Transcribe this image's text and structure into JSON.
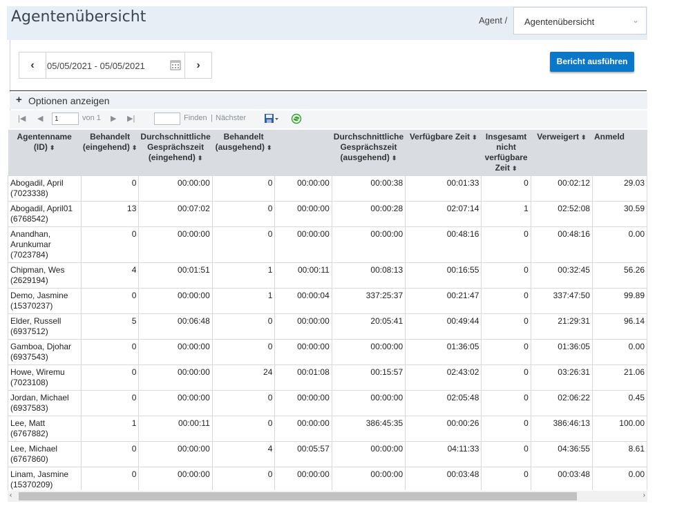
{
  "header": {
    "title": "Agentenübersicht",
    "breadcrumb": "Agent /",
    "select_value": "Agentenübersicht"
  },
  "date_range": {
    "value": "05/05/2021 - 05/05/2021"
  },
  "run_button": "Bericht ausführen",
  "options": {
    "label": "Optionen anzeigen"
  },
  "pager": {
    "page": "1",
    "of": "von 1",
    "find": "Finden",
    "divider": "|",
    "next": "Nächster"
  },
  "columns": [
    "Agentenname (ID)",
    "Behandelt (eingehend)",
    "Durchschnittliche Gesprächszeit (eingehend)",
    "Behandelt (ausgehend)",
    "",
    "Durchschnittliche Gesprächszeit (ausgehend)",
    "Verfügbare Zeit",
    "Insgesamt nicht verfügbare Zeit",
    "Verweigert",
    "Anmeld"
  ],
  "rows": [
    [
      "Abogadil, April (7023338)",
      "0",
      "00:00:00",
      "0",
      "00:00:00",
      "00:00:38",
      "00:01:33",
      "0",
      "00:02:12",
      "29.03"
    ],
    [
      "Abogadil, April01 (6768542)",
      "13",
      "00:07:02",
      "0",
      "00:00:00",
      "00:00:28",
      "02:07:14",
      "1",
      "02:52:08",
      "30.59"
    ],
    [
      "Anandhan, Arunkumar (7023784)",
      "0",
      "00:00:00",
      "0",
      "00:00:00",
      "00:00:00",
      "00:48:16",
      "0",
      "00:48:16",
      "0.00"
    ],
    [
      "Chipman, Wes (2629194)",
      "4",
      "00:01:51",
      "1",
      "00:00:11",
      "00:08:13",
      "00:16:55",
      "0",
      "00:32:45",
      "56.26"
    ],
    [
      "Demo, Jasmine (15370237)",
      "0",
      "00:00:00",
      "1",
      "00:00:04",
      "337:25:37",
      "00:21:47",
      "0",
      "337:47:50",
      "99.89"
    ],
    [
      "Elder, Russell (6937512)",
      "5",
      "00:06:48",
      "0",
      "00:00:00",
      "20:05:41",
      "00:49:44",
      "0",
      "21:29:31",
      "96.14"
    ],
    [
      "Gamboa, Djohar (6937543)",
      "0",
      "00:00:00",
      "0",
      "00:00:00",
      "00:00:00",
      "01:36:05",
      "0",
      "01:36:05",
      "0.00"
    ],
    [
      "Howe, Wiremu (7023108)",
      "0",
      "00:00:00",
      "24",
      "00:01:08",
      "00:15:57",
      "02:43:02",
      "0",
      "03:26:31",
      "21.06"
    ],
    [
      "Jordan, Michael (6937583)",
      "0",
      "00:00:00",
      "0",
      "00:00:00",
      "00:00:00",
      "02:05:48",
      "0",
      "02:06:22",
      "0.45"
    ],
    [
      "Lee, Matt (6767882)",
      "1",
      "00:00:11",
      "0",
      "00:00:00",
      "386:45:35",
      "00:00:26",
      "0",
      "386:46:13",
      "100.00"
    ],
    [
      "Lee, Michael (6767860)",
      "0",
      "00:00:00",
      "4",
      "00:05:57",
      "00:00:00",
      "04:11:33",
      "0",
      "04:36:55",
      "8.61"
    ],
    [
      "Linam, Jasmine (15370209)",
      "0",
      "00:00:00",
      "0",
      "00:00:00",
      "00:00:00",
      "00:03:48",
      "0",
      "00:03:48",
      "0.00"
    ]
  ]
}
